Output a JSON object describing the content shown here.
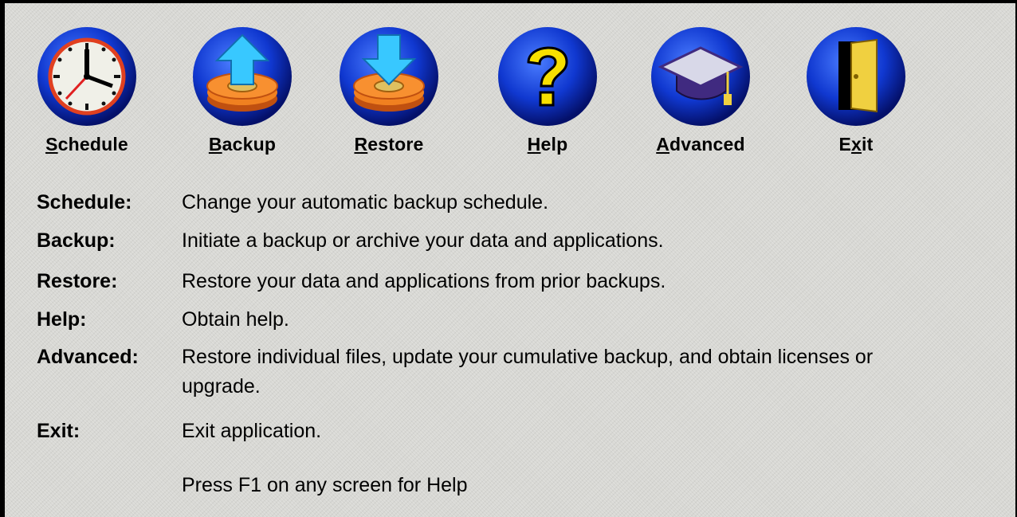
{
  "toolbar": {
    "buttons": [
      {
        "id": "schedule",
        "label_mnemonic": "S",
        "label_rest": "chedule",
        "icon": "clock-icon"
      },
      {
        "id": "backup",
        "label_mnemonic": "B",
        "label_rest": "ackup",
        "icon": "backup-arrow-up-icon"
      },
      {
        "id": "restore",
        "label_mnemonic": "R",
        "label_rest": "estore",
        "icon": "restore-arrow-down-icon"
      },
      {
        "id": "help",
        "label_mnemonic": "H",
        "label_rest": "elp",
        "icon": "question-mark-icon"
      },
      {
        "id": "advanced",
        "label_mnemonic": "A",
        "label_rest": "dvanced",
        "icon": "graduation-cap-icon"
      },
      {
        "id": "exit",
        "label_pre": "E",
        "label_mnemonic": "x",
        "label_rest": "it",
        "icon": "door-icon"
      }
    ]
  },
  "descriptions": [
    {
      "term": "Schedule:",
      "text": "Change your automatic backup schedule."
    },
    {
      "term": "Backup:",
      "text": "Initiate a backup or archive your data and applications."
    },
    {
      "term": "Restore:",
      "text": "Restore your data and applications from prior backups."
    },
    {
      "term": "Help:",
      "text": "Obtain help."
    },
    {
      "term": "Advanced:",
      "text": "Restore individual files, update your cumulative backup, and obtain licenses or upgrade."
    },
    {
      "term": "Exit:",
      "text": "Exit application."
    }
  ],
  "footer": {
    "hint": "Press F1 on any screen for Help"
  },
  "colors": {
    "disc_blue": "#1040d8",
    "platter_orange": "#f08020",
    "arrow_cyan": "#38c8ff",
    "help_yellow": "#f8e000",
    "cap_purple": "#402a80",
    "door_yellow": "#f0d040"
  }
}
